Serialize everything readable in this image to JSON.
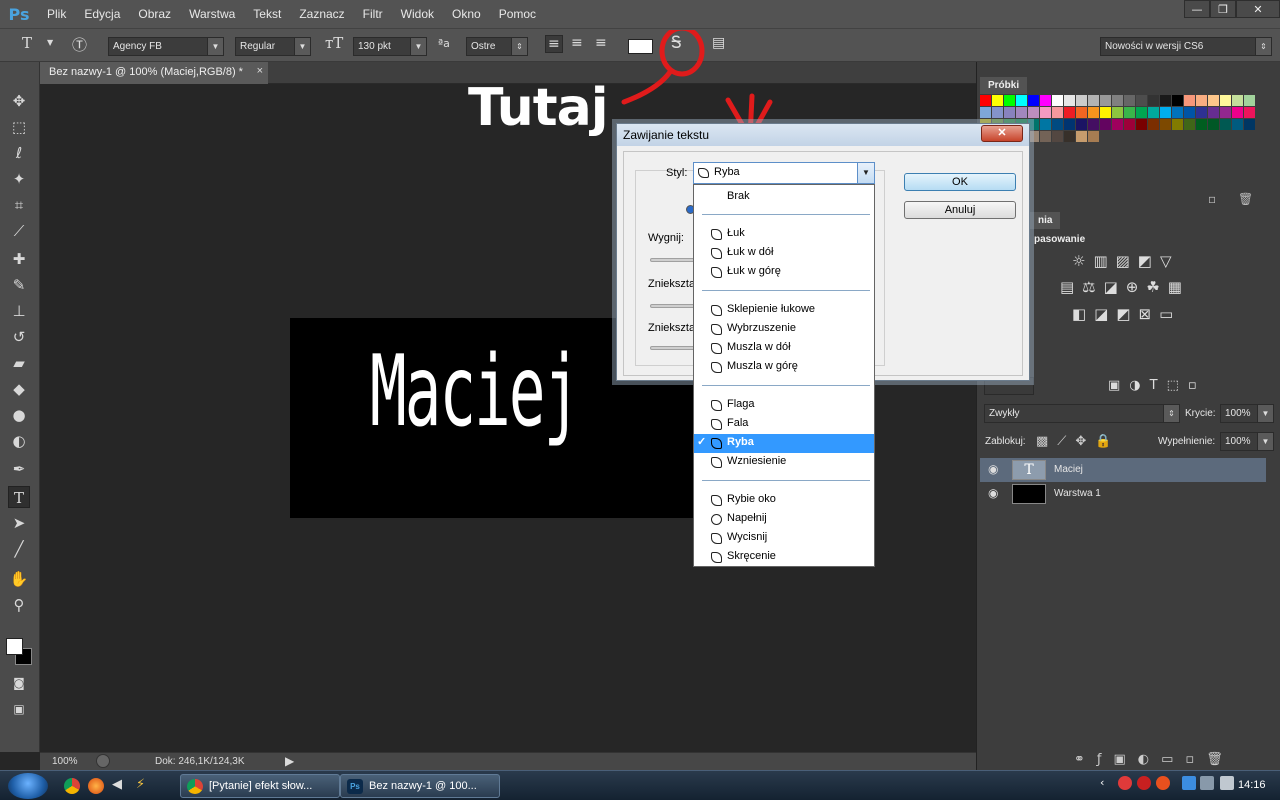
{
  "app": {
    "logo": "Ps"
  },
  "menu": [
    "Plik",
    "Edycja",
    "Obraz",
    "Warstwa",
    "Tekst",
    "Zaznacz",
    "Filtr",
    "Widok",
    "Okno",
    "Pomoc"
  ],
  "window_controls": {
    "minimize": "—",
    "restore": "❐",
    "close": "✕"
  },
  "options_bar": {
    "font_family": "Agency FB",
    "font_style": "Regular",
    "font_size": "130 pkt",
    "aa_label": "ªa",
    "antialias": "Ostre",
    "workspace": "Nowości w wersji CS6"
  },
  "document_tab": {
    "title": "Bez nazwy-1 @ 100% (Maciej,RGB/8) *",
    "close": "×"
  },
  "canvas": {
    "text": "Maciej"
  },
  "annotation": {
    "text": "Tutaj",
    "color": "#e01b1b"
  },
  "status_bar": {
    "zoom": "100%",
    "doc": "Dok: 246,1K/124,3K"
  },
  "panels": {
    "swatches_tab": "Próbki",
    "adjustments_tab": "nia",
    "adjustments_title": "pasowanie",
    "blend_mode": "Zwykły",
    "opacity_label": "Krycie:",
    "opacity": "100%",
    "lock_label": "Zablokuj:",
    "fill_label": "Wypełnienie:",
    "fill": "100%",
    "layers": [
      {
        "name": "Maciej",
        "type": "text",
        "selected": true
      },
      {
        "name": "Warstwa 1",
        "type": "fill",
        "selected": false
      }
    ]
  },
  "dialog": {
    "title": "Zawijanie tekstu",
    "close": "✕",
    "style_label": "Styl:",
    "style_value": "Ryba",
    "bend_label": "Wygnij:",
    "distort1_label": "Znieksztal",
    "distort2_label": "Znieksztal",
    "ok": "OK",
    "cancel": "Anuluj",
    "options": [
      {
        "label": "Brak",
        "group": 0
      },
      {
        "label": "Łuk",
        "group": 1
      },
      {
        "label": "Łuk w dół",
        "group": 1
      },
      {
        "label": "Łuk w górę",
        "group": 1
      },
      {
        "label": "Sklepienie łukowe",
        "group": 2
      },
      {
        "label": "Wybrzuszenie",
        "group": 2
      },
      {
        "label": "Muszla w dół",
        "group": 2
      },
      {
        "label": "Muszla w górę",
        "group": 2
      },
      {
        "label": "Flaga",
        "group": 3
      },
      {
        "label": "Fala",
        "group": 3
      },
      {
        "label": "Ryba",
        "group": 3,
        "selected": true
      },
      {
        "label": "Wzniesienie",
        "group": 3
      },
      {
        "label": "Rybie oko",
        "group": 4
      },
      {
        "label": "Napełnij",
        "group": 4
      },
      {
        "label": "Wycisnij",
        "group": 4
      },
      {
        "label": "Skręcenie",
        "group": 4
      }
    ]
  },
  "taskbar": {
    "items": [
      {
        "label": "[Pytanie] efekt słow...",
        "icon": "chrome-icon"
      },
      {
        "label": "Bez nazwy-1 @ 100...",
        "icon": "photoshop-icon"
      }
    ],
    "clock": "14:16"
  },
  "colors": {
    "accent": "#3399ff",
    "ps_blue": "#4aa3df"
  }
}
